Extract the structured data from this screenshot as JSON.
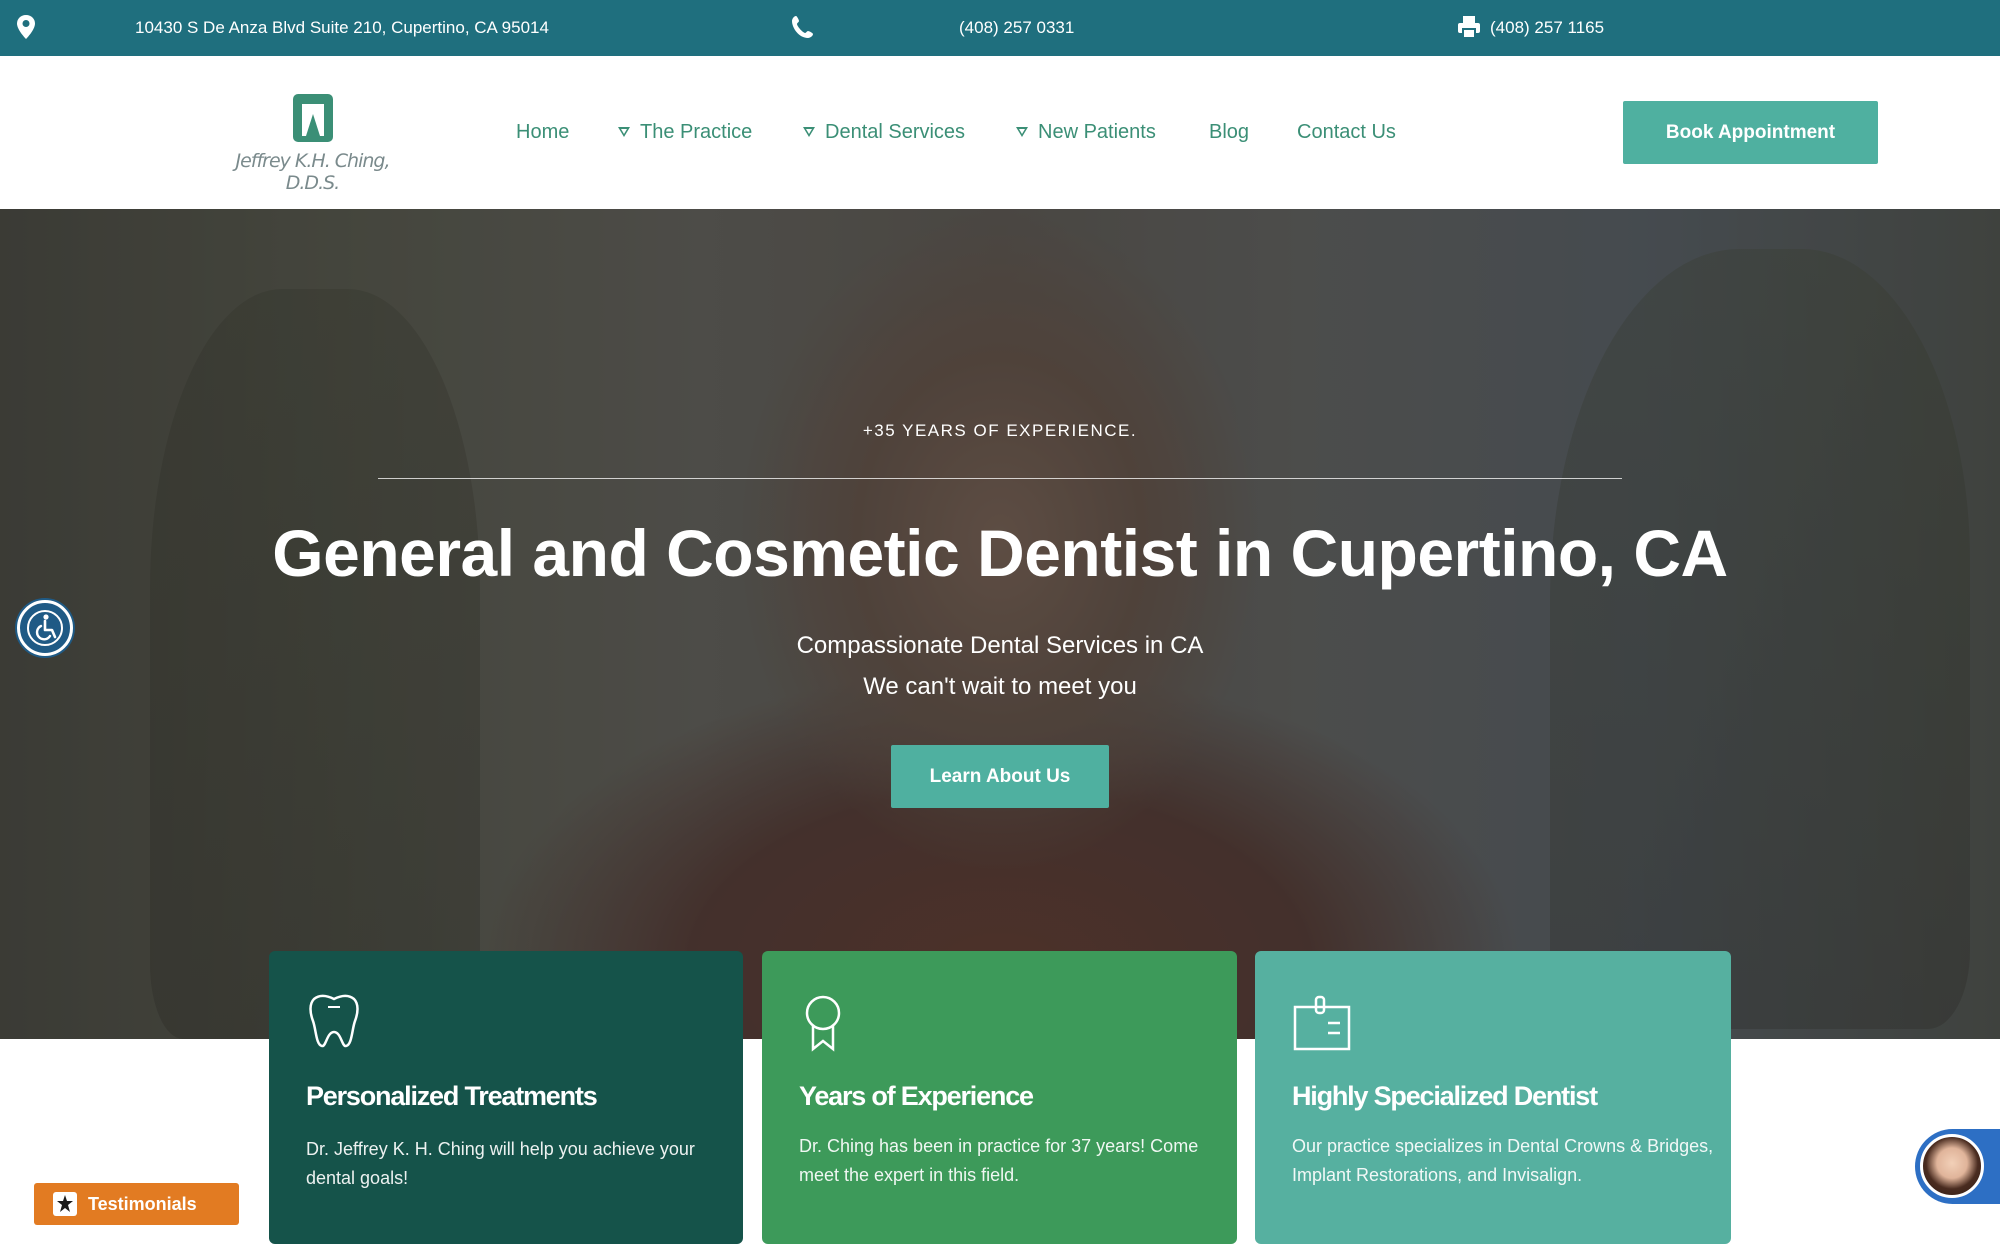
{
  "topbar": {
    "address": "10430 S De Anza Blvd Suite 210, Cupertino, CA 95014",
    "phone": "(408) 257 0331",
    "fax": "(408) 257 1165"
  },
  "logo": {
    "text": "Jeffrey K.H. Ching, D.D.S."
  },
  "nav": {
    "home": "Home",
    "practice": "The Practice",
    "services": "Dental Services",
    "patients": "New Patients",
    "blog": "Blog",
    "contact": "Contact Us"
  },
  "header": {
    "book_label": "Book Appointment"
  },
  "hero": {
    "kicker": "+35 YEARS OF EXPERIENCE.",
    "title": "General and Cosmetic Dentist in Cupertino, CA",
    "subtitle_line1": "Compassionate Dental Services in CA",
    "subtitle_line2": "We can't wait to meet you",
    "button_label": "Learn About Us"
  },
  "cards": [
    {
      "title": "Personalized Treatments",
      "text": "Dr. Jeffrey K. H. Ching will help you achieve your dental goals!",
      "color": "#15534a",
      "icon": "tooth-icon"
    },
    {
      "title": "Years of Experience",
      "text": "Dr. Ching has been in practice for 37 years! Come meet the expert in this field.",
      "color": "#3d9a5a",
      "icon": "award-ribbon-icon"
    },
    {
      "title": "Highly Specialized Dentist",
      "text": "Our practice specializes in Dental Crowns & Bridges, Implant Restorations, and Invisalign.",
      "color": "#56b0a0",
      "icon": "id-badge-icon"
    }
  ],
  "widgets": {
    "testimonials_label": "Testimonials"
  },
  "colors": {
    "topbar": "#1f6f7e",
    "accent": "#4fb0a0",
    "nav_text": "#3b8f76",
    "testimonials": "#e27b22"
  }
}
